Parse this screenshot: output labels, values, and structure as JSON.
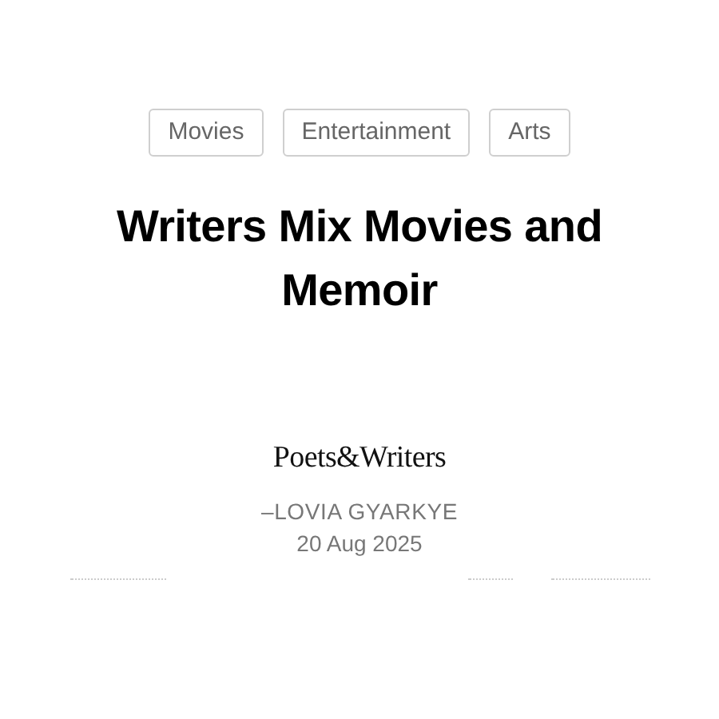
{
  "tags": [
    {
      "label": "Movies"
    },
    {
      "label": "Entertainment"
    },
    {
      "label": "Arts"
    }
  ],
  "title": "Writers Mix Movies and Memoir",
  "source": "Poets&Writers",
  "author": "–LOVIA GYARKYE",
  "date": "20 Aug 2025"
}
